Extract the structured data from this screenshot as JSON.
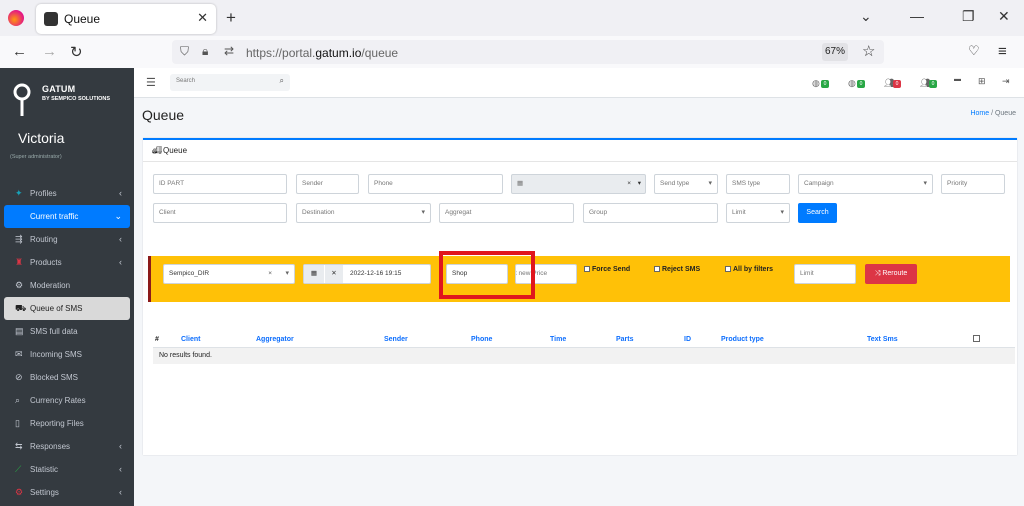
{
  "browser": {
    "tab_title": "Queue",
    "url_prefix": "https://portal.",
    "url_host": "gatum.io",
    "url_path": "/queue",
    "zoom": "67%"
  },
  "sidebar": {
    "brand": "GATUM",
    "brand_sub": "BY SEMPICO SOLUTIONS",
    "user_name": "Victoria",
    "user_role": "(Super administrator)",
    "items": [
      {
        "label": "Profiles",
        "icon": "profiles-icon",
        "chevron": true
      },
      {
        "label": "Current traffic",
        "icon": "",
        "chevron": true,
        "active": true
      },
      {
        "label": "Routing",
        "icon": "routing-icon",
        "chevron": true
      },
      {
        "label": "Products",
        "icon": "products-icon",
        "chevron": true
      },
      {
        "label": "Moderation",
        "icon": "moderation-icon",
        "chevron": false
      },
      {
        "label": "Queue of SMS",
        "icon": "queue-icon",
        "chevron": false,
        "selected": true
      },
      {
        "label": "SMS full data",
        "icon": "sms-data-icon",
        "chevron": false
      },
      {
        "label": "Incoming SMS",
        "icon": "incoming-icon",
        "chevron": false
      },
      {
        "label": "Blocked SMS",
        "icon": "blocked-icon",
        "chevron": false
      },
      {
        "label": "Currency Rates",
        "icon": "currency-icon",
        "chevron": false
      },
      {
        "label": "Reporting Files",
        "icon": "files-icon",
        "chevron": false
      },
      {
        "label": "Responses",
        "icon": "responses-icon",
        "chevron": true
      },
      {
        "label": "Statistic",
        "icon": "statistic-icon",
        "chevron": true
      },
      {
        "label": "Settings",
        "icon": "settings-icon",
        "chevron": true
      }
    ]
  },
  "topnav": {
    "search_placeholder": "Search",
    "badges": [
      {
        "count": "0",
        "color": "#28a745"
      },
      {
        "count": "0",
        "color": "#28a745"
      },
      {
        "count": "0",
        "color": "#dc3545"
      },
      {
        "count": "0",
        "color": "#28a745"
      }
    ]
  },
  "page": {
    "title": "Queue",
    "breadcrumb_home": "Home",
    "breadcrumb_current": "Queue"
  },
  "card": {
    "title": "Queue",
    "filters_row1": {
      "id_part": "ID PART",
      "sender": "Sender",
      "phone": "Phone",
      "send_type": "Send type",
      "sms_type": "SMS type",
      "campaign": "Campaign",
      "priority": "Priority"
    },
    "filters_row2": {
      "client": "Client",
      "destination": "Destination",
      "aggregat": "Aggregat",
      "group": "Group",
      "limit": "Limit",
      "search_button": "Search"
    },
    "action_bar": {
      "aggregator": "Sempico_DIR",
      "datetime": "2022-12-16 19:15",
      "shop": "Shop",
      "new_price": "Set new Price",
      "force_send": "Force Send",
      "reject_sms": "Reject SMS",
      "all_by_filters": "All by filters",
      "limit": "Limit",
      "reroute_button": "Reroute"
    },
    "table": {
      "columns": [
        "#",
        "Client",
        "Aggregator",
        "Sender",
        "Phone",
        "Time",
        "Parts",
        "ID",
        "Product type",
        "Text Sms"
      ],
      "empty_message": "No results found."
    }
  }
}
